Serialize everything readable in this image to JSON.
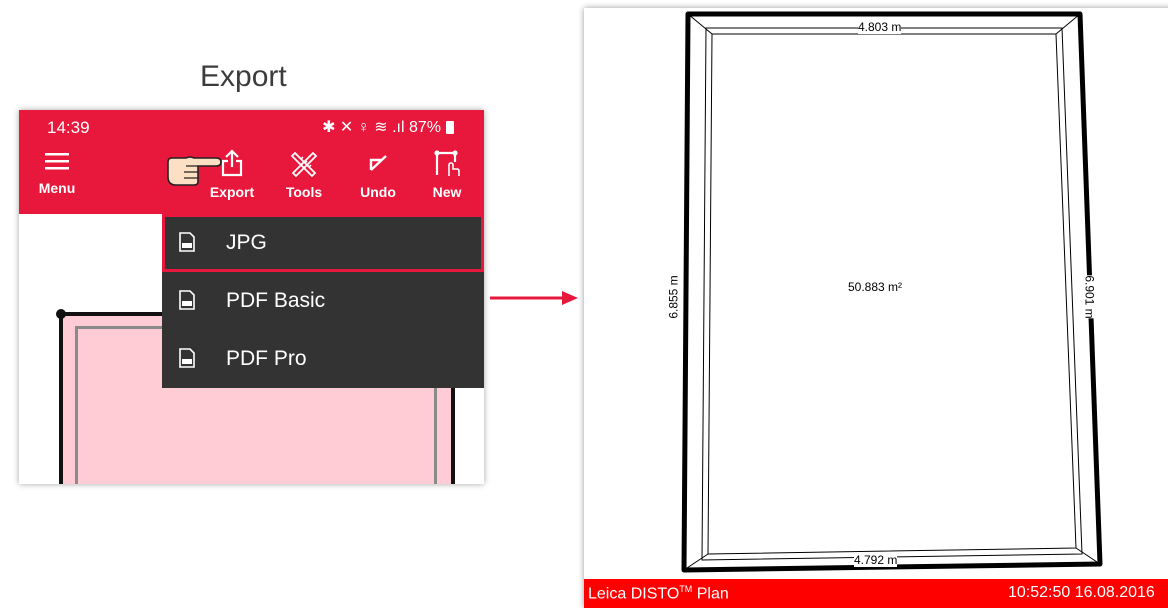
{
  "slide_title": "Export",
  "phone": {
    "status_time": "14:39",
    "status_icons_text": "✱ ✕ ♀ ≋ .ıl 87%",
    "toolbar": {
      "menu_label": "Menu",
      "export_label": "Export",
      "tools_label": "Tools",
      "undo_label": "Undo",
      "new_label": "New"
    },
    "export_menu": [
      {
        "label": "JPG",
        "icon": "jpg-file-icon",
        "selected": true
      },
      {
        "label": "PDF Basic",
        "icon": "pdf-file-icon"
      },
      {
        "label": "PDF Pro",
        "icon": "pdf-file-icon"
      }
    ],
    "accent_color": "#e8173c",
    "room_fill_color": "#ffccd5"
  },
  "preview": {
    "top_length": "4.803 m",
    "bottom_length": "4.792 m",
    "left_length": "6.855 m",
    "right_length": "6.901 m",
    "area": "50.883 m²",
    "footer_left_prefix": "Leica DISTO",
    "footer_left_tm": "TM",
    "footer_left_suffix": " Plan",
    "footer_right": "10:52:50 16.08.2016",
    "footer_color": "#ff0000"
  },
  "hand_icon": "pointing-hand-icon",
  "arrow_icon": "right-arrow-icon"
}
